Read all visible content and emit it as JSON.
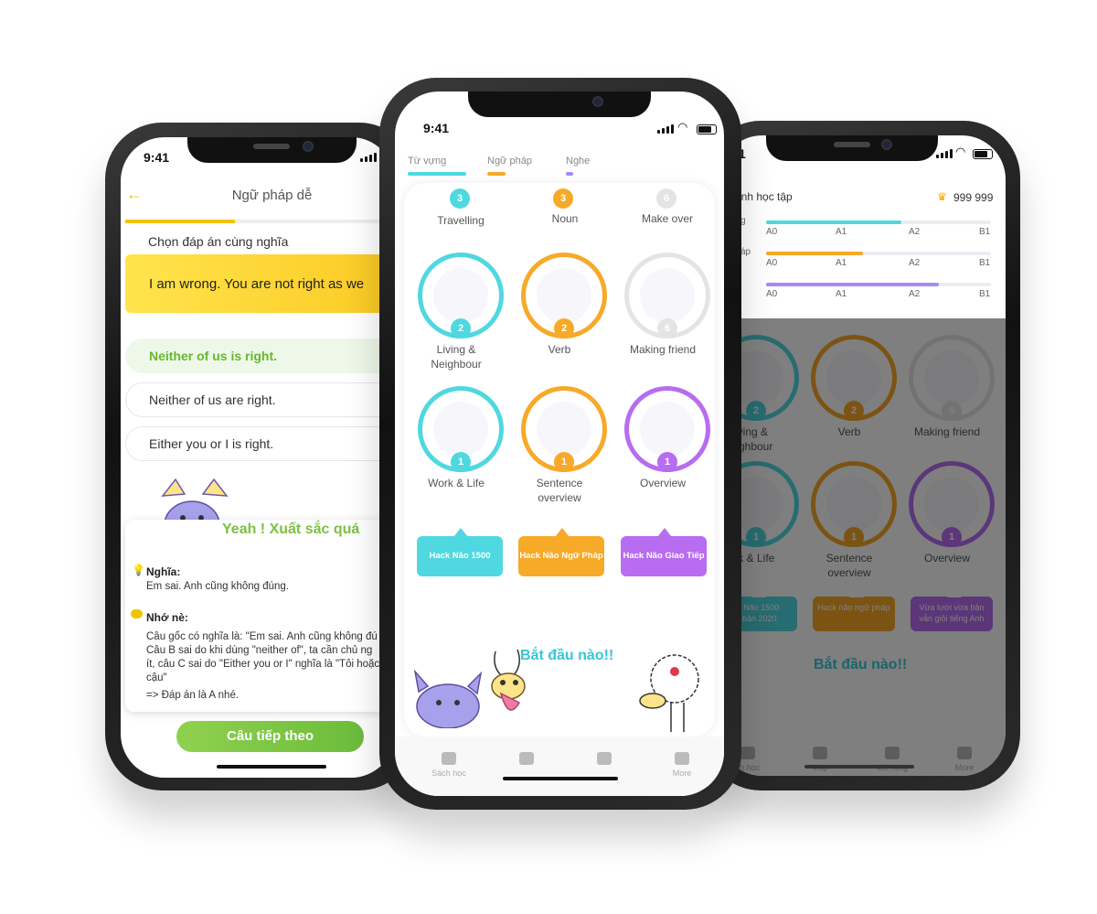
{
  "status": {
    "time": "9:41"
  },
  "left_phone": {
    "title": "Ngữ pháp dễ",
    "back_icon": "arrow-left-icon",
    "prompt": "Chọn đáp án cùng nghĩa",
    "question": "I am wrong. You are not right as we",
    "options": [
      "Neither of us is right.",
      "Neither of us are right.",
      "Either you or I is right."
    ],
    "feedback_title": "Yeah ! Xuất sắc quá",
    "meaning_heading": "Nghĩa:",
    "meaning_text": "Em sai. Anh cũng không đúng.",
    "note_heading": "Nhớ nè:",
    "note_lines": [
      "Câu gốc có nghĩa là: \"Em sai. Anh cũng không đú",
      "Câu B sai do khi dùng \"neither of\", ta cần chủ ng",
      "ít, câu C sai do \"Either you or I\" nghĩa là \"Tôi hoặc",
      "cậu\"",
      "=> Đáp án là A nhé."
    ],
    "next_button": "Câu tiếp theo"
  },
  "center_phone": {
    "tabs": [
      {
        "label": "Từ vựng",
        "color": "#4fd8e0"
      },
      {
        "label": "Ngữ pháp",
        "color": "#f7a928"
      },
      {
        "label": "Nghe",
        "color": "#a78bf0"
      }
    ],
    "top_row": [
      {
        "label": "Travelling",
        "badge": "3",
        "color": "#4fd8e0"
      },
      {
        "label": "Noun",
        "badge": "3",
        "color": "#f7a928"
      },
      {
        "label": "Make over",
        "badge": "6",
        "color": "#dddddd"
      }
    ],
    "lessons": [
      {
        "label": "Living &\nNeighbour",
        "badge": "2",
        "color": "#4fd8e0"
      },
      {
        "label": "Verb",
        "badge": "2",
        "color": "#f7a928"
      },
      {
        "label": "Making friend",
        "badge": "6",
        "color": "#e4e4e4"
      },
      {
        "label": "Work & Life",
        "badge": "1",
        "color": "#4fd8e0"
      },
      {
        "label": "Sentence\noverview",
        "badge": "1",
        "color": "#f7a928"
      },
      {
        "label": "Overview",
        "badge": "1",
        "color": "#b86cf0"
      }
    ],
    "hacks": [
      {
        "label": "Hack Não 1500",
        "color": "#4fd8e0"
      },
      {
        "label": "Hack Não Ngữ Pháp",
        "color": "#f7a928"
      },
      {
        "label": "Hack Não Giao Tiếp",
        "color": "#b86cf0"
      }
    ],
    "start_text": "Bắt đầu nào!!",
    "nav": [
      {
        "label": "Sách học",
        "icon": "book-icon"
      },
      {
        "label": "",
        "icon": "map-flag-icon"
      },
      {
        "label": "",
        "icon": "grid-icon"
      },
      {
        "label": "More",
        "icon": "user-icon"
      }
    ]
  },
  "right_phone": {
    "title": "Trình học tập",
    "title_visible": "inh học tập",
    "score": "999 999",
    "level_side_labels": [
      "g",
      "áp",
      ""
    ],
    "level_ticks": [
      "A0",
      "A1",
      "A2",
      "B1"
    ],
    "levels": [
      {
        "fill": 0.6,
        "color": "#4fd8e0"
      },
      {
        "fill": 0.43,
        "color": "#f7a928"
      },
      {
        "fill": 0.77,
        "color": "#a78bf0"
      }
    ],
    "lessons": [
      {
        "label": "iving &\neighbour",
        "badge": "2",
        "color": "#4fd8e0"
      },
      {
        "label": "Verb",
        "badge": "2",
        "color": "#f7a928"
      },
      {
        "label": "Making friend",
        "badge": "6",
        "color": "#e4e4e4"
      },
      {
        "label": "ork & Life",
        "badge": "1",
        "color": "#4fd8e0"
      },
      {
        "label": "Sentence\noverview",
        "badge": "1",
        "color": "#f7a928"
      },
      {
        "label": "Overview",
        "badge": "1",
        "color": "#b86cf0"
      }
    ],
    "hacks": [
      {
        "label": "ck Não 1500\nn bản 2020",
        "color": "#4fd8e0"
      },
      {
        "label": "Hack não ngữ pháp",
        "color": "#f7a928"
      },
      {
        "label": "Vừa lười vừa bận\nvẫn giỏi tiếng Anh",
        "color": "#b86cf0"
      }
    ],
    "start_text": "Bắt đầu nào!!",
    "nav": [
      {
        "label": "ch học",
        "icon": "book-icon"
      },
      {
        "label": "Map",
        "icon": "map-flag-icon"
      },
      {
        "label": "Mở rộng",
        "icon": "grid-icon"
      },
      {
        "label": "More",
        "icon": "user-icon"
      }
    ]
  }
}
